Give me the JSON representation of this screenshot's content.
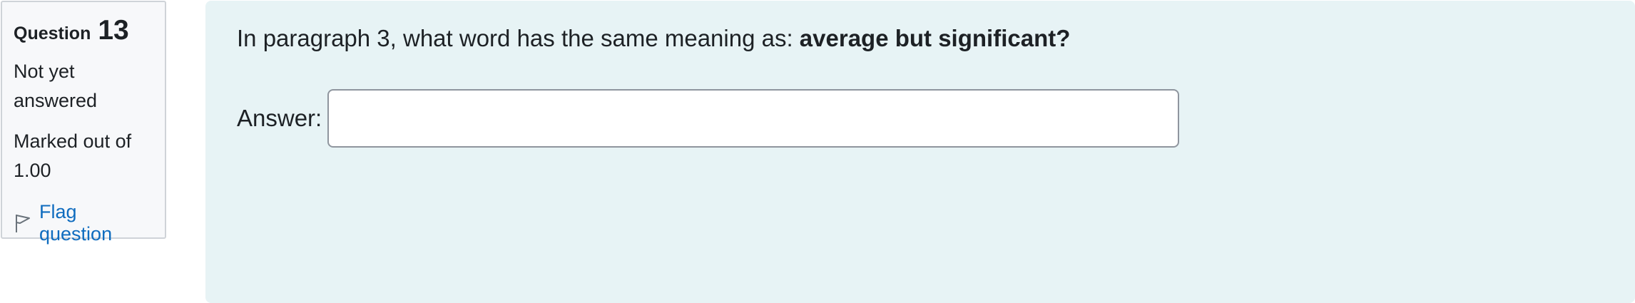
{
  "info": {
    "question_label": "Question",
    "question_number": "13",
    "status": "Not yet answered",
    "marks": "Marked out of 1.00",
    "flag_label": "Flag question",
    "flag_icon": "flag-outline-icon"
  },
  "question": {
    "prompt": "In paragraph 3, what word has the same meaning as: ",
    "prompt_emphasis": "average but significant?",
    "answer_label": "Answer:",
    "answer_value": ""
  },
  "colors": {
    "info_bg": "#f7f8fa",
    "content_bg": "#e7f3f5",
    "link": "#0f6cbf",
    "text": "#1d2125"
  }
}
